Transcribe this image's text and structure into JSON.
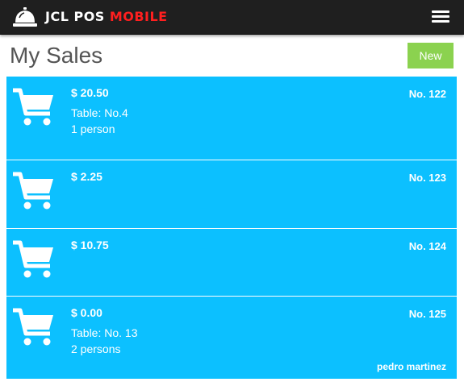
{
  "header": {
    "brand_part1": "JCL POS",
    "brand_part2": "MOBILE",
    "logo_icon": "service-bell-icon",
    "menu_icon": "hamburger-menu-icon"
  },
  "page": {
    "title": "My Sales",
    "new_label": "New"
  },
  "colors": {
    "topbar": "#1f1f1f",
    "brand_accent": "#ff1f1f",
    "sale_card": "#0cc0ff",
    "new_button": "#8bd24f",
    "title_text": "#555555"
  },
  "sales": [
    {
      "amount": "$ 20.50",
      "number": "No. 122",
      "table": "Table: No.4",
      "persons": "1 person",
      "waiter": "",
      "icon": "shopping-cart-icon"
    },
    {
      "amount": "$ 2.25",
      "number": "No. 123",
      "table": "",
      "persons": "",
      "waiter": "",
      "icon": "shopping-cart-icon"
    },
    {
      "amount": "$ 10.75",
      "number": "No. 124",
      "table": "",
      "persons": "",
      "waiter": "",
      "icon": "shopping-cart-icon"
    },
    {
      "amount": "$ 0.00",
      "number": "No. 125",
      "table": "Table: No. 13",
      "persons": "2 persons",
      "waiter": "pedro martinez",
      "icon": "shopping-cart-icon"
    }
  ]
}
